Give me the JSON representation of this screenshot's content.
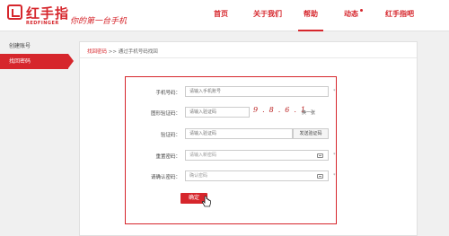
{
  "brand": {
    "name_cn": "红手指",
    "name_en": "REDFINGER",
    "slogan": "你的第一台手机"
  },
  "nav": {
    "items": [
      "首页",
      "关于我们",
      "帮助",
      "动态",
      "红手指吧"
    ],
    "active": "帮助"
  },
  "sidebar": {
    "items": [
      "创建账号",
      "找回密码"
    ],
    "active": "找回密码"
  },
  "breadcrumb": {
    "link": "找回密码",
    "separator": ">>",
    "current": "通过手机号码找回"
  },
  "form": {
    "phone": {
      "label": "手机号码：",
      "placeholder": "请输入手机账号",
      "required": "*"
    },
    "image_code": {
      "label": "图形验证码：",
      "placeholder": "请输入验证码",
      "captcha_text": "9.8.6.1",
      "refresh_label": "换一张"
    },
    "sms_code": {
      "label": "验证码：",
      "placeholder": "请输入验证码",
      "button": "发送验证码"
    },
    "new_password": {
      "label": "重置密码：",
      "placeholder": "请输入新密码",
      "required": "*"
    },
    "confirm_password": {
      "label": "请确认密码：",
      "placeholder": "确认密码",
      "required": "*"
    },
    "submit": "确定"
  },
  "colors": {
    "brand_red": "#d6262c",
    "background": "#f0f0f0"
  },
  "icons": [
    "logo-mark-icon",
    "keyboard-icon",
    "cursor-hand-icon"
  ]
}
